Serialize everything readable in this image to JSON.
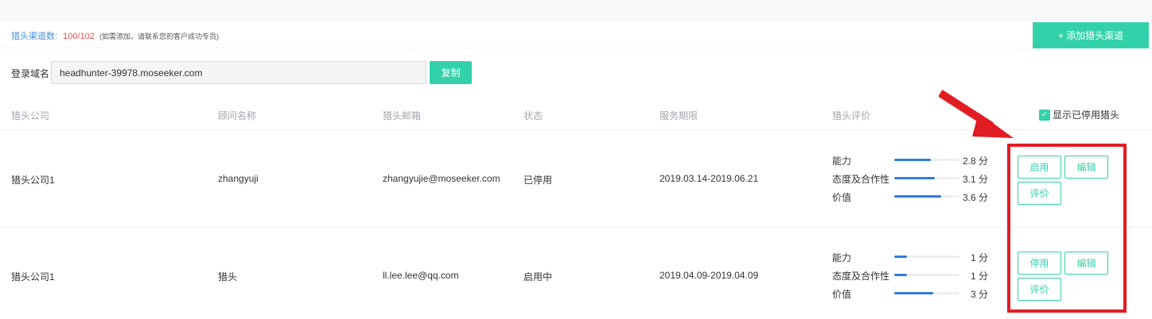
{
  "summary": {
    "label": "猎头渠道数:",
    "count": "100/102",
    "note": "(如需添加，请联系您的客户成功专员)"
  },
  "add_button_label": "+ 添加猎头渠道",
  "domain": {
    "label": "登录域名",
    "value": "headhunter-39978.moseeker.com",
    "copy_label": "复制"
  },
  "table": {
    "columns": [
      "猎头公司",
      "顾问名称",
      "猎头邮箱",
      "状态",
      "服务期限",
      "猎头评价"
    ],
    "show_disabled_label": "显示已停用猎头",
    "show_disabled_checked": true,
    "rows": [
      {
        "company": "猎头公司1",
        "consultant": "zhangyuji",
        "email": "zhangyujie@moseeker.com",
        "status": "已停用",
        "period": "2019.03.14-2019.06.21",
        "ratings": [
          {
            "label": "能力",
            "score": "2.8 分",
            "fraction": 0.56
          },
          {
            "label": "态度及合作性",
            "score": "3.1 分",
            "fraction": 0.62
          },
          {
            "label": "价值",
            "score": "3.6 分",
            "fraction": 0.72
          }
        ],
        "actions": {
          "toggle": "启用",
          "edit": "编辑",
          "rate": "评价"
        }
      },
      {
        "company": "猎头公司1",
        "consultant": "猎头",
        "email": "ll.lee.lee@qq.com",
        "status": "启用中",
        "period": "2019.04.09-2019.04.09",
        "ratings": [
          {
            "label": "能力",
            "score": "1 分",
            "fraction": 0.2
          },
          {
            "label": "态度及合作性",
            "score": "1 分",
            "fraction": 0.2
          },
          {
            "label": "价值",
            "score": "3 分",
            "fraction": 0.6
          }
        ],
        "actions": {
          "toggle": "停用",
          "edit": "编辑",
          "rate": "评价"
        }
      }
    ]
  },
  "colors": {
    "accent": "#33d1aa",
    "link_blue": "#4a90d9",
    "count_red": "#e8534f",
    "bar_blue": "#2f7be0",
    "annotation_red": "#e11c22"
  }
}
